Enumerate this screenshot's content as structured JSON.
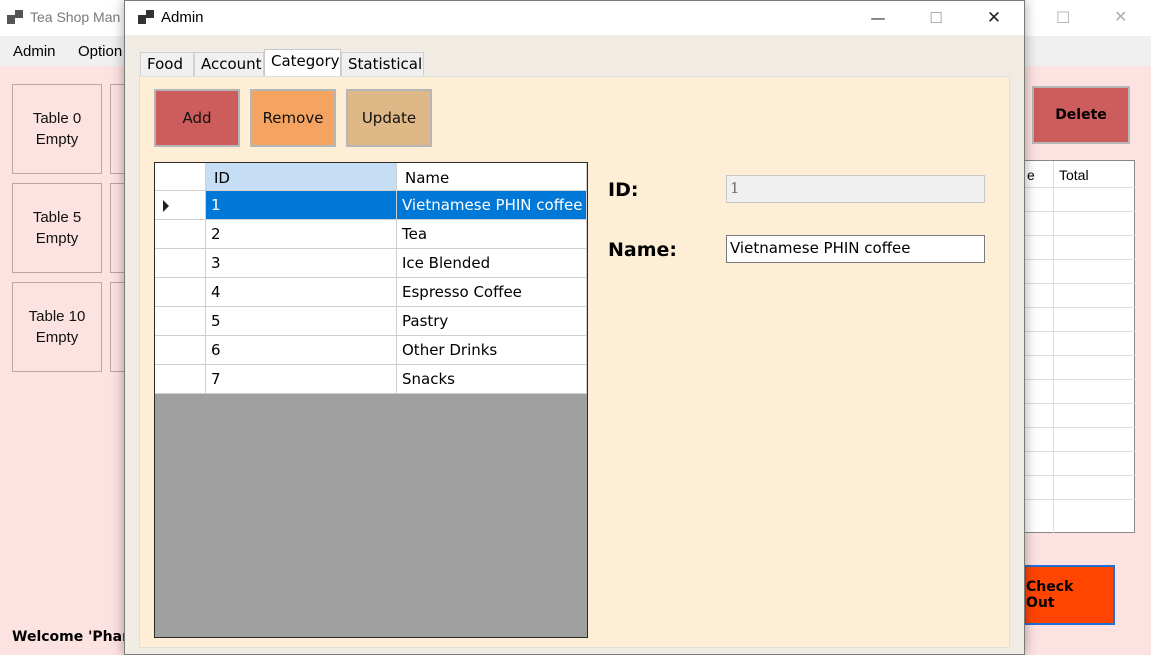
{
  "background_window": {
    "title": "Tea Shop Man",
    "menu": [
      "Admin",
      "Option"
    ],
    "tables": [
      {
        "name": "Table 0",
        "status": "Empty"
      },
      {
        "name": "Table 5",
        "status": "Empty"
      },
      {
        "name": "Table 10",
        "status": "Empty"
      }
    ],
    "delete_label": "Delete",
    "checkout_label": "Check Out",
    "bill_headers": [
      "e",
      "Total"
    ],
    "welcome": "Welcome 'Phan"
  },
  "dialog": {
    "title": "Admin",
    "controls": {
      "minimize": "—",
      "maximize": "☐",
      "close": "✕"
    },
    "tabs": [
      "Food",
      "Account",
      "Category",
      "Statistical"
    ],
    "active_tab": "Category",
    "buttons": {
      "add": "Add",
      "remove": "Remove",
      "update": "Update"
    },
    "grid": {
      "columns": [
        "ID",
        "Name"
      ],
      "rows": [
        {
          "id": "1",
          "name": "Vietnamese PHIN coffee"
        },
        {
          "id": "2",
          "name": "Tea"
        },
        {
          "id": "3",
          "name": "Ice Blended"
        },
        {
          "id": "4",
          "name": "Espresso Coffee"
        },
        {
          "id": "5",
          "name": "Pastry"
        },
        {
          "id": "6",
          "name": "Other Drinks"
        },
        {
          "id": "7",
          "name": "Snacks"
        }
      ],
      "selected_index": 0
    },
    "form": {
      "id_label": "ID:",
      "id_value": "1",
      "name_label": "Name:",
      "name_value": "Vietnamese PHIN coffee"
    }
  },
  "colors": {
    "add": "#cd5c5c",
    "remove": "#f4a460",
    "update": "#deb887",
    "selection": "#0078d7",
    "panel": "#ffeed6",
    "delete": "#cd5c5c",
    "checkout": "#ff4500"
  }
}
